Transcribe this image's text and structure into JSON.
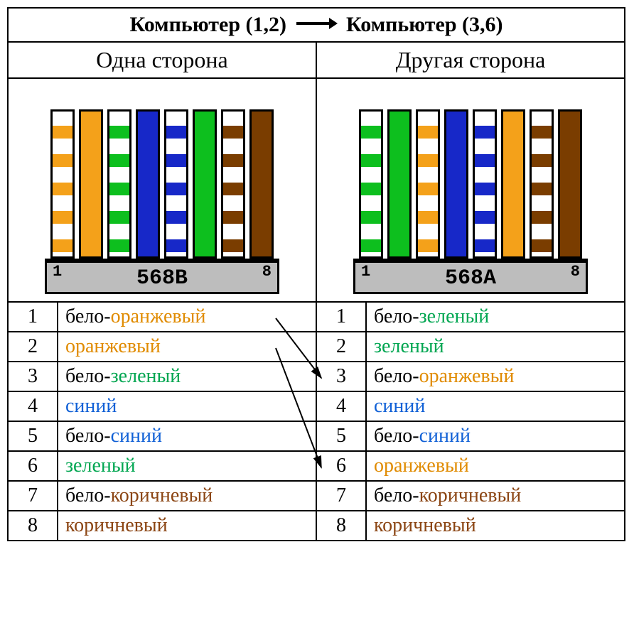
{
  "title": {
    "left": "Компьютер (1,2)",
    "right": "Компьютер (3,6)"
  },
  "headers": {
    "left": "Одна сторона",
    "right": "Другая сторона"
  },
  "connectors": {
    "left": {
      "pin1": "1",
      "pin8": "8",
      "standard": "568B"
    },
    "right": {
      "pin1": "1",
      "pin8": "8",
      "standard": "568A"
    }
  },
  "wire_order": {
    "left": [
      "wo",
      "o",
      "wg",
      "b",
      "wb",
      "g",
      "wbr",
      "br"
    ],
    "right": [
      "wg",
      "g",
      "wo",
      "b",
      "wb",
      "o",
      "wbr",
      "br"
    ]
  },
  "stripe_colors": {
    "wo": "#f4a11a",
    "wg": "#0dbf1e",
    "wb": "#1728c8",
    "wbr": "#7a3d00"
  },
  "rows": [
    {
      "n": "1",
      "left": [
        {
          "t": "бело-",
          "c": "black"
        },
        {
          "t": "оранжевый",
          "c": "orange"
        }
      ],
      "right": [
        {
          "t": "бело-",
          "c": "black"
        },
        {
          "t": "зеленый",
          "c": "green"
        }
      ]
    },
    {
      "n": "2",
      "left": [
        {
          "t": "оранжевый",
          "c": "orange"
        }
      ],
      "right": [
        {
          "t": "зеленый",
          "c": "green"
        }
      ]
    },
    {
      "n": "3",
      "left": [
        {
          "t": "бело-",
          "c": "black"
        },
        {
          "t": "зеленый",
          "c": "green"
        }
      ],
      "right": [
        {
          "t": "бело-",
          "c": "black"
        },
        {
          "t": "оранжевый",
          "c": "orange"
        }
      ]
    },
    {
      "n": "4",
      "left": [
        {
          "t": "синий",
          "c": "blue"
        }
      ],
      "right": [
        {
          "t": "синий",
          "c": "blue"
        }
      ]
    },
    {
      "n": "5",
      "left": [
        {
          "t": "бело-",
          "c": "black"
        },
        {
          "t": "синий",
          "c": "blue"
        }
      ],
      "right": [
        {
          "t": "бело-",
          "c": "black"
        },
        {
          "t": "синий",
          "c": "blue"
        }
      ]
    },
    {
      "n": "6",
      "left": [
        {
          "t": "зеленый",
          "c": "green"
        }
      ],
      "right": [
        {
          "t": "оранжевый",
          "c": "orange"
        }
      ]
    },
    {
      "n": "7",
      "left": [
        {
          "t": "бело-",
          "c": "black"
        },
        {
          "t": "коричневый",
          "c": "brown"
        }
      ],
      "right": [
        {
          "t": "бело-",
          "c": "black"
        },
        {
          "t": "коричневый",
          "c": "brown"
        }
      ]
    },
    {
      "n": "8",
      "left": [
        {
          "t": "коричневый",
          "c": "brown"
        }
      ],
      "right": [
        {
          "t": "коричневый",
          "c": "brown"
        }
      ]
    }
  ],
  "cross_arrows": [
    {
      "from_row": 1,
      "to_row": 3
    },
    {
      "from_row": 2,
      "to_row": 6
    }
  ]
}
